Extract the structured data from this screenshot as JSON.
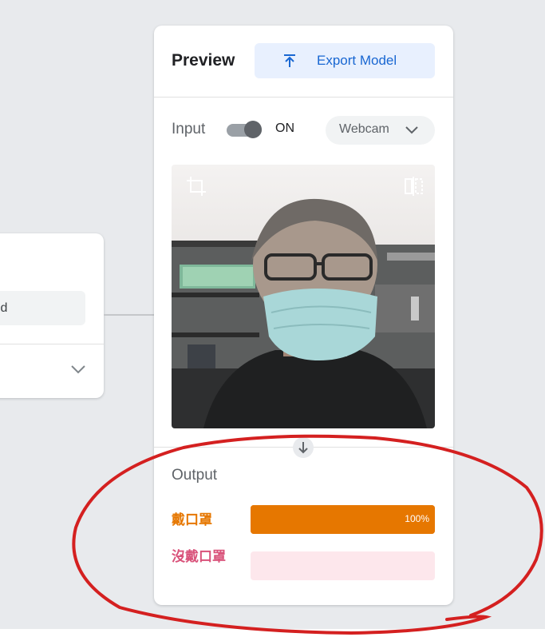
{
  "training": {
    "trained_label": "Model Trained"
  },
  "preview": {
    "title": "Preview",
    "export_button": "Export Model",
    "input_label": "Input",
    "toggle_state": "ON",
    "source_select": "Webcam",
    "output_title": "Output",
    "classes": [
      {
        "label": "戴口罩",
        "confidence": 1.0,
        "percent_label": "100%",
        "color": "#e67700",
        "track_color": "#e67700"
      },
      {
        "label": "沒戴口罩",
        "confidence": 0.0,
        "percent_label": "",
        "color": "#d9527a",
        "track_color": "#fde7ec"
      }
    ]
  },
  "annotation": {
    "color": "#d42020"
  }
}
